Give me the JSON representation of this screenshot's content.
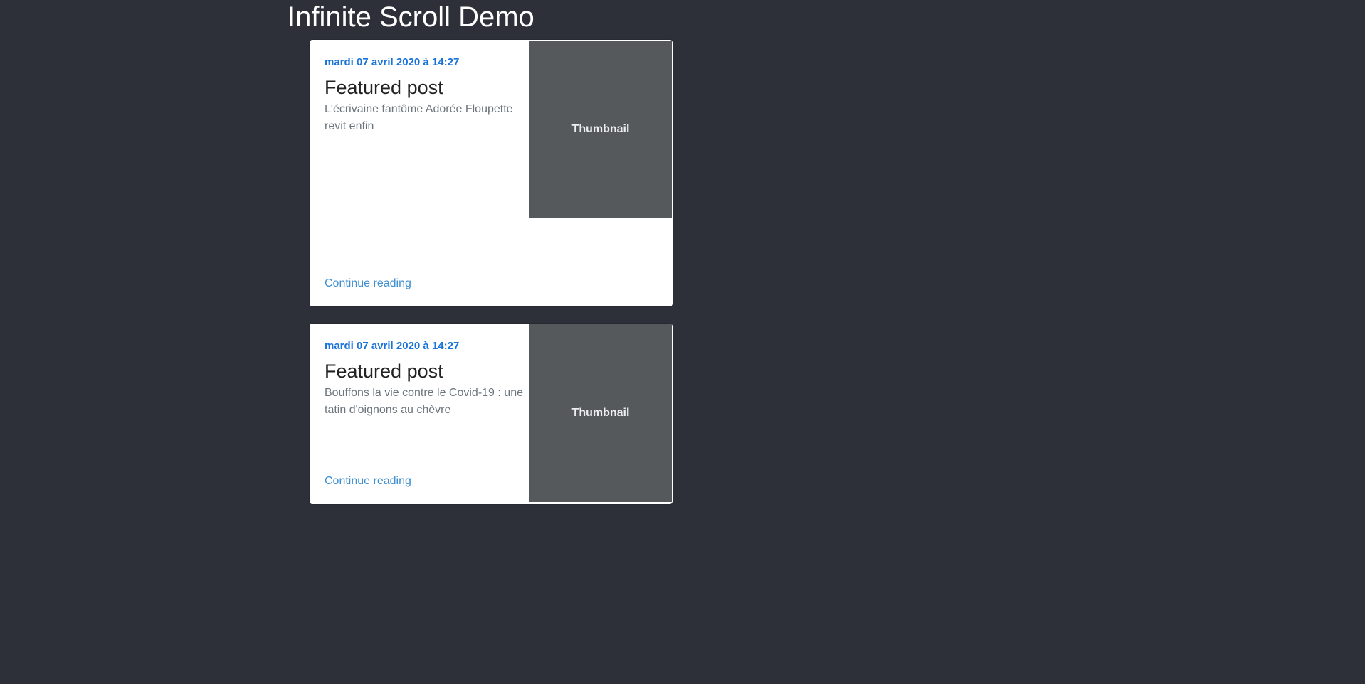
{
  "page": {
    "title": "Infinite Scroll Demo"
  },
  "posts": [
    {
      "date": "mardi 07 avril 2020 à 14:27",
      "title": "Featured post",
      "excerpt": "L'écrivaine fantôme Adorée Floupette revit enfin",
      "link_label": "Continue reading",
      "thumbnail_label": "Thumbnail"
    },
    {
      "date": "mardi 07 avril 2020 à 14:27",
      "title": "Featured post",
      "excerpt": "Bouffons la vie contre le Covid-19 : une tatin d'oignons au chèvre",
      "link_label": "Continue reading",
      "thumbnail_label": "Thumbnail"
    }
  ],
  "colors": {
    "background": "#2e3039",
    "date": "#1a73d8",
    "link": "#3d8fd1",
    "thumbnail": "#55595c"
  }
}
